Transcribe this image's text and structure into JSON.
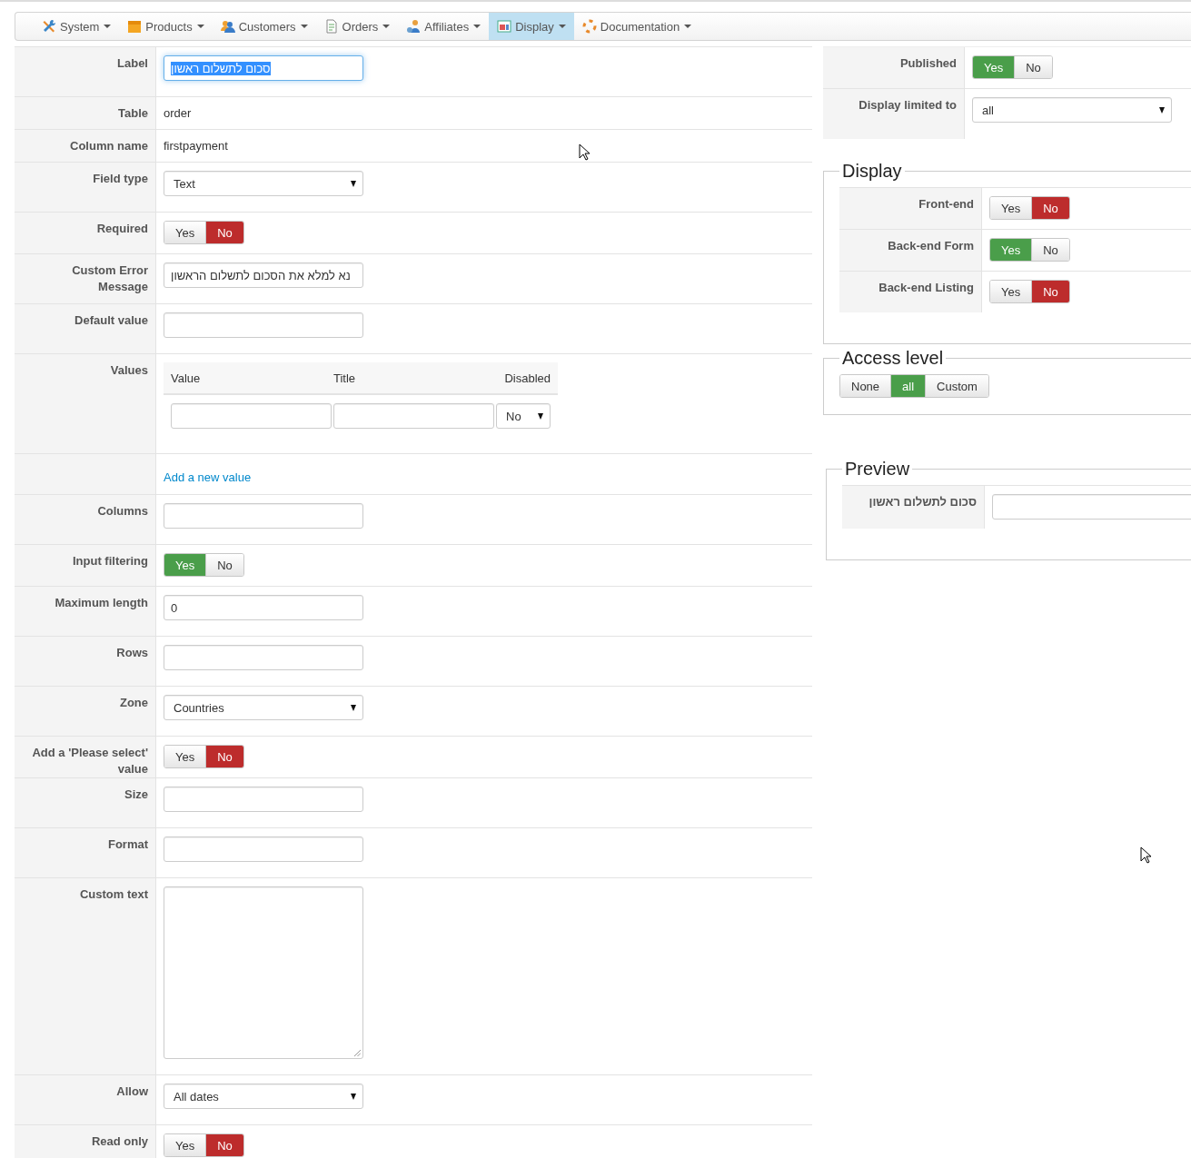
{
  "nav": [
    {
      "label": "System",
      "selected": false
    },
    {
      "label": "Products",
      "selected": false
    },
    {
      "label": "Customers",
      "selected": false
    },
    {
      "label": "Orders",
      "selected": false
    },
    {
      "label": "Affiliates",
      "selected": false
    },
    {
      "label": "Display",
      "selected": true
    },
    {
      "label": "Documentation",
      "selected": false
    }
  ],
  "form": {
    "rows": [
      {
        "kind": "input",
        "label": "Label",
        "value": "סכום לתשלום ראשון",
        "text_selected": true
      },
      {
        "kind": "static",
        "label": "Table",
        "value": "order"
      },
      {
        "kind": "static",
        "label": "Column name",
        "value": "firstpayment"
      },
      {
        "kind": "select",
        "label": "Field type",
        "value": "Text"
      },
      {
        "kind": "toggle",
        "label": "Required",
        "options": [
          {
            "label": "Yes",
            "selected": false
          },
          {
            "label": "No",
            "kind": "no",
            "selected": true
          }
        ]
      },
      {
        "kind": "input",
        "label": "Custom Error Message",
        "value": "נא למלא את הסכום לתשלום הראשון"
      },
      {
        "kind": "input",
        "label": "Default value"
      },
      {
        "kind": "values",
        "label": "Values",
        "columns": [
          "Value",
          "Title",
          "Disabled"
        ],
        "rows": [
          {
            "disabled": "No"
          }
        ]
      },
      {
        "kind": "link",
        "value": "Add a new value"
      },
      {
        "kind": "input",
        "label": "Columns"
      },
      {
        "kind": "toggle",
        "label": "Input filtering",
        "options": [
          {
            "label": "Yes",
            "kind": "yes",
            "selected": true
          },
          {
            "label": "No",
            "selected": false
          }
        ]
      },
      {
        "kind": "input",
        "label": "Maximum length",
        "value": "0"
      },
      {
        "kind": "input",
        "label": "Rows"
      },
      {
        "kind": "select",
        "label": "Zone",
        "value": "Countries"
      },
      {
        "kind": "toggle",
        "label": "Add a 'Please select' value",
        "options": [
          {
            "label": "Yes",
            "selected": false
          },
          {
            "label": "No",
            "kind": "no",
            "selected": true
          }
        ]
      },
      {
        "kind": "input",
        "label": "Size"
      },
      {
        "kind": "input",
        "label": "Format"
      },
      {
        "kind": "textarea",
        "label": "Custom text"
      },
      {
        "kind": "select",
        "label": "Allow",
        "value": "All dates"
      },
      {
        "kind": "toggle",
        "label": "Read only",
        "options": [
          {
            "label": "Yes",
            "selected": false
          },
          {
            "label": "No",
            "kind": "no",
            "selected": true
          }
        ]
      }
    ]
  },
  "settings": {
    "rows": [
      {
        "kind": "toggle",
        "label": "Published",
        "options": [
          {
            "label": "Yes",
            "kind": "yes",
            "selected": true
          },
          {
            "label": "No",
            "selected": false
          }
        ]
      },
      {
        "kind": "select",
        "label": "Display limited to",
        "value": "all"
      }
    ]
  },
  "display": {
    "title": "Display",
    "rows": [
      {
        "kind": "toggle",
        "label": "Front-end",
        "options": [
          {
            "label": "Yes",
            "selected": false
          },
          {
            "label": "No",
            "kind": "no",
            "selected": true
          }
        ]
      },
      {
        "kind": "toggle",
        "label": "Back-end Form",
        "options": [
          {
            "label": "Yes",
            "kind": "yes",
            "selected": true
          },
          {
            "label": "No",
            "selected": false
          }
        ]
      },
      {
        "kind": "toggle",
        "label": "Back-end Listing",
        "options": [
          {
            "label": "Yes",
            "selected": false
          },
          {
            "label": "No",
            "kind": "no",
            "selected": true
          }
        ]
      }
    ]
  },
  "access_level": {
    "title": "Access level",
    "options": [
      {
        "label": "None",
        "selected": false
      },
      {
        "label": "all",
        "kind": "yes",
        "selected": true
      },
      {
        "label": "Custom",
        "selected": false
      }
    ]
  },
  "preview": {
    "title": "Preview",
    "label": "סכום לתשלום ראשון"
  }
}
